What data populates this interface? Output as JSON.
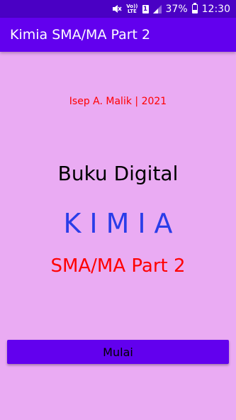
{
  "status_bar": {
    "volte_line1": "Vo))",
    "volte_line2": "LTE",
    "sim_slot": "1",
    "battery_percent": "37%",
    "time": "12:30",
    "battery_level": 0.37,
    "icons": [
      "mute-icon",
      "volte-icon",
      "sim-icon",
      "signal-icon",
      "battery-icon"
    ]
  },
  "app_bar": {
    "title": "Kimia SMA/MA Part 2"
  },
  "content": {
    "author": "Isep A. Malik | 2021",
    "subtitle": "Buku Digital",
    "main_title": "KIMIA",
    "edition": "SMA/MA Part 2"
  },
  "button": {
    "label": "Mulai"
  },
  "colors": {
    "background": "#eaabf3",
    "status_bar": "#4a00c4",
    "app_bar": "#6200ee",
    "button": "#6200ee",
    "author": "#ff0000",
    "main_title": "#2a3de8",
    "edition": "#ff0000"
  }
}
